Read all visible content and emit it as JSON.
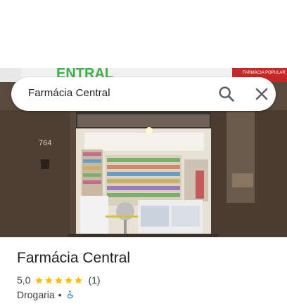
{
  "search": {
    "query": "Farmácia Central",
    "search_icon": "search-icon",
    "clear_icon": "close-icon"
  },
  "photo": {
    "sign_text": "ENTRAL",
    "side_sign_text": "FARMÁCIA POPULAR",
    "building_number": "764",
    "alt": "storefront-photo"
  },
  "place": {
    "name": "Farmácia Central",
    "rating": "5,0",
    "stars": 5,
    "review_count": "(1)",
    "category": "Drogaria",
    "separator": "•",
    "accessibility_icon": "wheelchair-icon"
  },
  "colors": {
    "star": "#fbbc04",
    "accessible": "#1a73e8",
    "sign_green": "#3fae49",
    "sign_red": "#c62828"
  }
}
